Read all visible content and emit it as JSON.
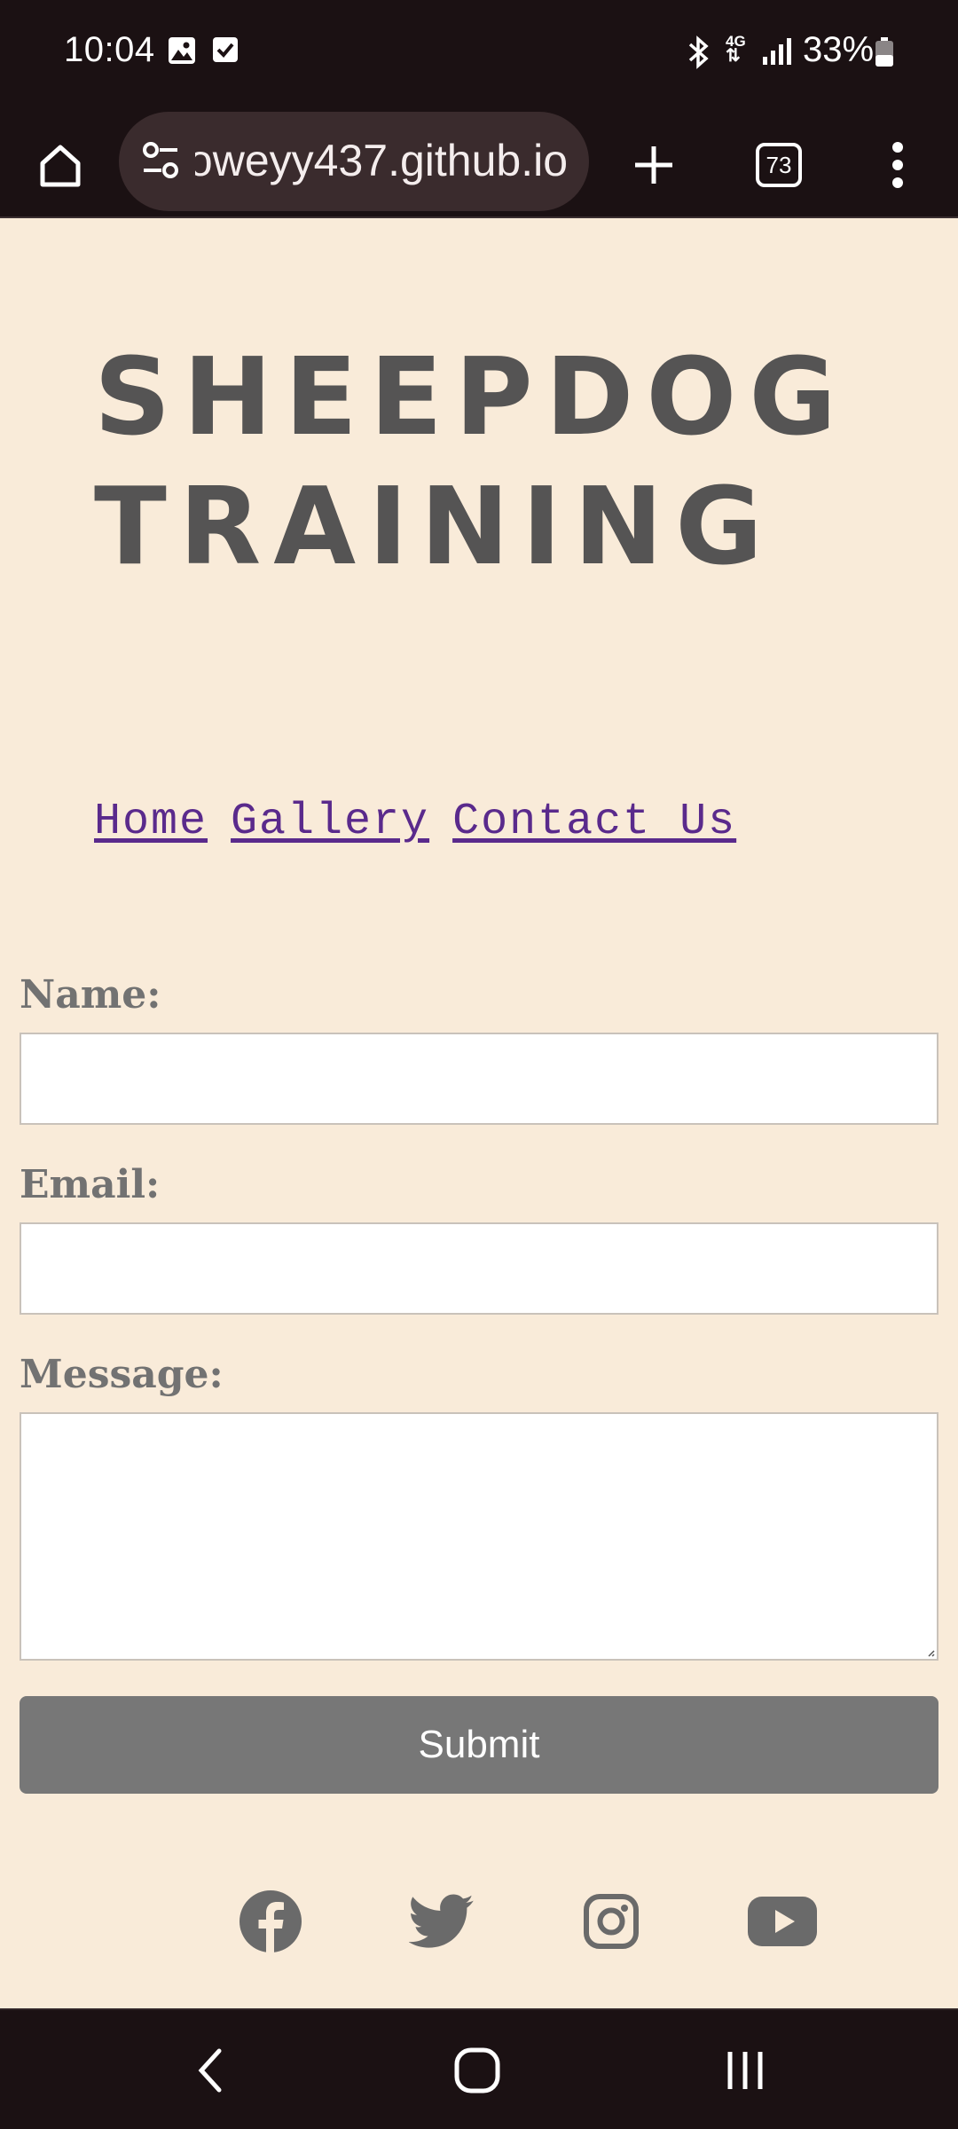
{
  "status_bar": {
    "time": "10:04",
    "battery": "33%",
    "network": "4G"
  },
  "browser": {
    "url": "oweyy437.github.io",
    "tabs_count": "73"
  },
  "site": {
    "title_line1": "SHEEPDOG",
    "title_line2": "TRAINING",
    "nav": {
      "home": "Home",
      "gallery": "Gallery",
      "contact": "Contact Us"
    }
  },
  "form": {
    "name_label": "Name:",
    "name_value": "",
    "email_label": "Email:",
    "email_value": "",
    "message_label": "Message:",
    "message_value": "",
    "submit_label": "Submit"
  },
  "social": [
    "facebook-icon",
    "twitter-icon",
    "instagram-icon",
    "youtube-icon"
  ],
  "colors": {
    "page_bg": "#f9ebd9",
    "title": "#555454",
    "link": "#5a2a8c",
    "button": "#777777",
    "chrome": "#1b1113"
  }
}
